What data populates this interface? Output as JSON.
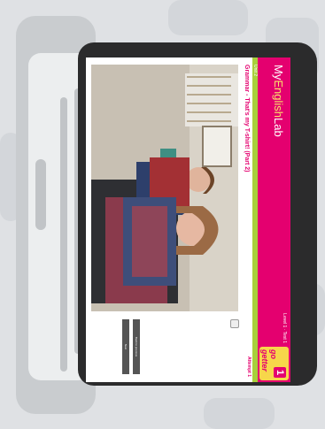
{
  "app": {
    "brand_prefix": "My",
    "brand_accent": "English",
    "brand_suffix": "Lab",
    "header_info": "Level 1 · Test 1",
    "unit_label": "Unit 2",
    "lesson_title": "Grammar - That's my T-shirt! (Part 2)",
    "attempt_label": "Attempt 1",
    "logo_text": "go getter",
    "logo_number": "1",
    "buttons": {
      "back": "Back to previous",
      "next": "Next"
    }
  },
  "icons": {
    "corner": "square-icon"
  },
  "colors": {
    "brand_pink": "#e4006f",
    "brand_green": "#a8cf3b",
    "logo_yellow": "#f7d64a",
    "bezel": "#2b2b2c"
  }
}
